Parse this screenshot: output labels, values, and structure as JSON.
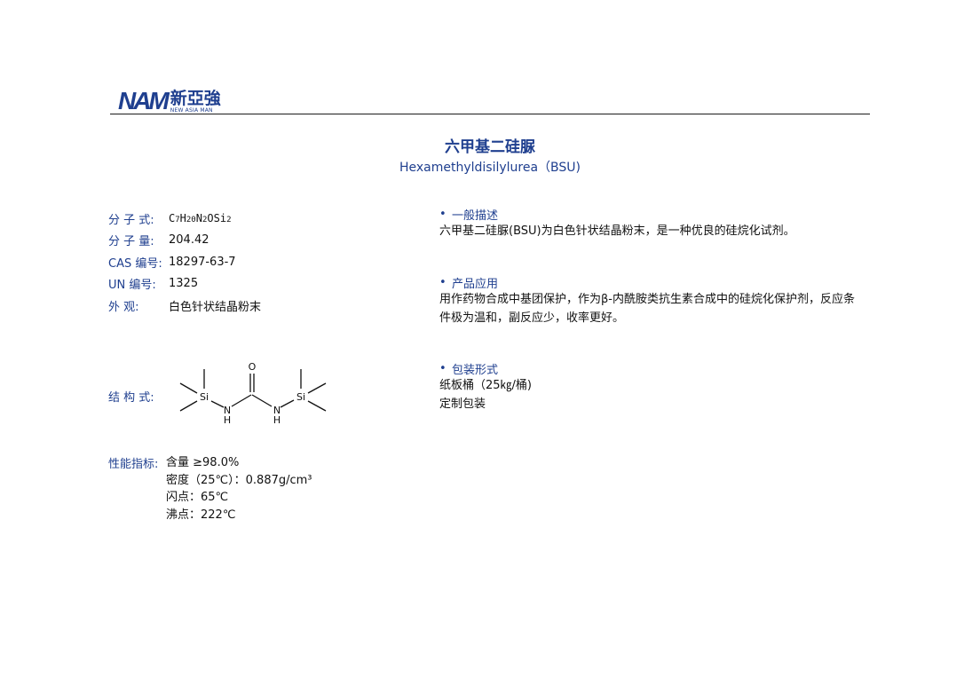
{
  "logo": {
    "mark": "NAM",
    "name_cn": "新亞強",
    "name_en": "NEW ASIA MAN"
  },
  "title": {
    "cn": "六甲基二硅脲",
    "en": "Hexamethyldisilylurea（BSU)"
  },
  "properties": [
    {
      "label": "分 子 式:",
      "value": ""
    },
    {
      "label": "分 子 量:",
      "value": "204.42"
    },
    {
      "label": "CAS 编号:",
      "value": "18297-63-7"
    },
    {
      "label": "UN  编号:",
      "value": "1325"
    },
    {
      "label": "外      观:",
      "value": "白色针状结晶粉末"
    }
  ],
  "formula": {
    "p1": "C",
    "s1": "7",
    "p2": "H",
    "s2": "20",
    "p3": "N",
    "s3": "2",
    "p4": "OSi",
    "s4": "2"
  },
  "structure": {
    "label": "结 构 式:",
    "atoms": {
      "si": "Si",
      "n": "N",
      "h": "H",
      "o": "O"
    }
  },
  "specs": {
    "label": "性能指标:",
    "items": [
      "含量 ≥98.0%",
      "密度（25℃）：0.887g/cm³",
      "闪点：65℃",
      "沸点：222℃"
    ]
  },
  "sections": [
    {
      "bullet": "•",
      "heading": "一般描述",
      "lines": [
        "六甲基二硅脲(BSU)为白色针状结晶粉末，是一种优良的硅烷化试剂。"
      ]
    },
    {
      "bullet": "•",
      "heading": "产品应用",
      "lines": [
        "用作药物合成中基团保护，作为β-内酰胺类抗生素合成中的硅烷化保护剂，反应条",
        "件极为温和，副反应少，收率更好。"
      ]
    },
    {
      "bullet": "•",
      "heading": "包装形式",
      "lines": [
        "纸板桶（25㎏/桶)",
        "定制包装"
      ]
    }
  ]
}
